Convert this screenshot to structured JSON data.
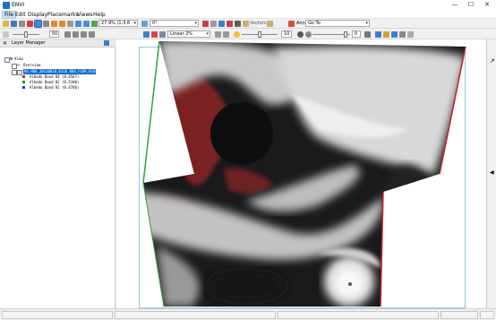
{
  "app": {
    "title": "ENVI"
  },
  "window_controls": {
    "minimize": "—",
    "maximize": "☐",
    "close": "✕"
  },
  "menu": [
    "File",
    "Edit",
    "Display",
    "Placemarks",
    "Views",
    "Help"
  ],
  "toolbar1": {
    "zoom_value": "27.9% (1:3.6",
    "rotation_value": "0°",
    "vectors_label": "Vectors",
    "annotations_label": "Annotations",
    "goto_value": "Go To"
  },
  "toolbar2": {
    "opacity_value": "50",
    "stretch_value": "Linear 2%",
    "brightness_value": "10",
    "contrast_value": "0"
  },
  "layer_manager": {
    "title": "Layer Manager",
    "tree": {
      "root": "View",
      "overview": "Overview",
      "file": "HS_H08_20150810_0110_B04_FLDK_R10",
      "bands": [
        {
          "label": "Albedo Band 04 (0.8567)",
          "color": "#d42020"
        },
        {
          "label": "Albedo Band 02 (0.5100)",
          "color": "#1b9a1b"
        },
        {
          "label": "Albedo Band 01 (0.4706)",
          "color": "#2030d0"
        }
      ]
    }
  },
  "colors": {
    "selection": "#0b6bd3",
    "view_frame": "#8fc7dd",
    "title_icon": "#1d6fc7"
  }
}
